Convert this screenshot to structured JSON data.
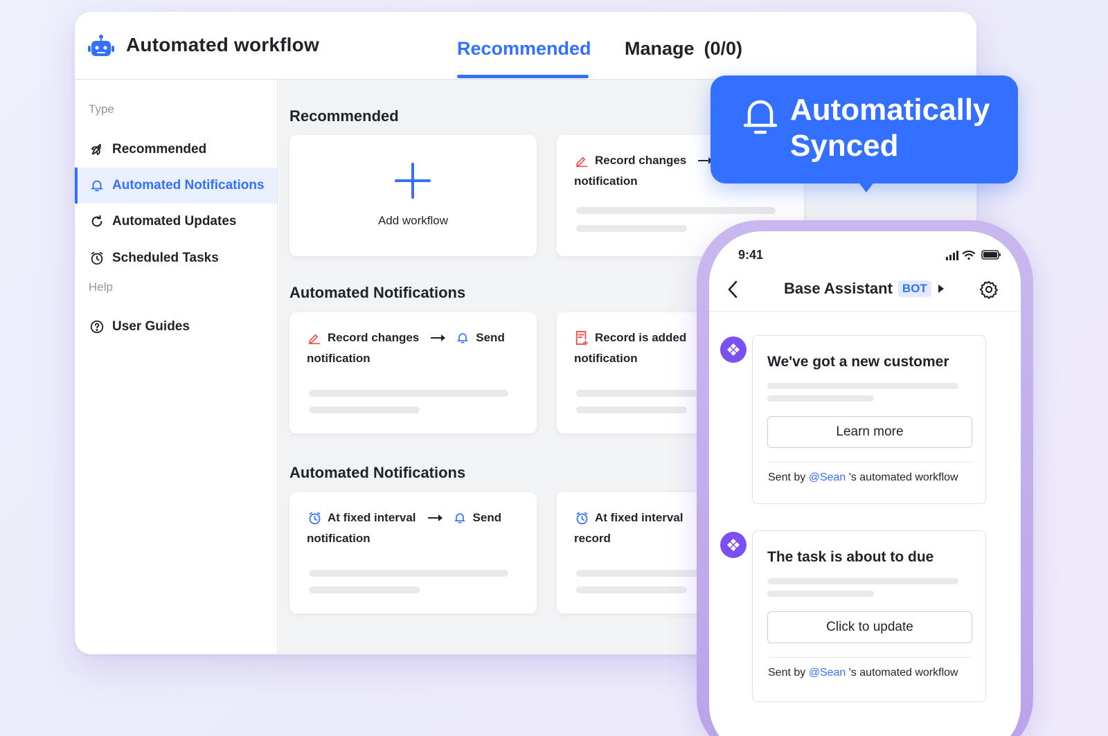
{
  "app": {
    "title": "Automated workflow"
  },
  "tabs": [
    {
      "label": "Recommended",
      "active": true
    },
    {
      "label": "Manage",
      "count": "(0/0)"
    }
  ],
  "sidebar": {
    "type_label": "Type",
    "help_label": "Help",
    "items": [
      {
        "label": "Recommended",
        "icon": "rocket-icon"
      },
      {
        "label": "Automated Notifications",
        "icon": "bell-icon",
        "active": true
      },
      {
        "label": "Automated Updates",
        "icon": "refresh-icon"
      },
      {
        "label": "Scheduled Tasks",
        "icon": "clock-icon"
      }
    ],
    "help_items": [
      {
        "label": "User Guides",
        "icon": "question-circle-icon"
      }
    ]
  },
  "sections": [
    {
      "title": "Recommended",
      "add_card": {
        "label": "Add workflow"
      },
      "cards": [
        {
          "trigger": "Record changes",
          "trigger_icon": "edit-icon",
          "line2": "notification"
        }
      ]
    },
    {
      "title": "Automated Notifications",
      "cards": [
        {
          "trigger": "Record changes",
          "trigger_icon": "edit-icon",
          "action": "Send",
          "action_icon": "bell-icon",
          "line2": "notification"
        },
        {
          "trigger": "Record is added",
          "trigger_icon": "form-add-icon",
          "line2": "notification"
        }
      ]
    },
    {
      "title": "Automated Notifications",
      "cards": [
        {
          "trigger": "At fixed interval",
          "trigger_icon": "alarm-clock-icon",
          "action": "Send",
          "action_icon": "bell-icon",
          "line2": "notification"
        },
        {
          "trigger": "At fixed interval",
          "trigger_icon": "alarm-clock-icon",
          "line2": "record"
        }
      ]
    }
  ],
  "bubble": {
    "line1": "Automatically",
    "line2": "Synced",
    "icon": "bell-icon"
  },
  "phone": {
    "time": "9:41",
    "chat_title": "Base Assistant",
    "badge": "BOT",
    "messages": [
      {
        "title": "We've got a new customer",
        "button": "Learn more",
        "sent_by": "Sent by",
        "mention": "@Sean",
        "suffix": "'s automated workflow"
      },
      {
        "title": "The task is about to due",
        "button": "Click to update",
        "sent_by": "Sent by",
        "mention": "@Sean",
        "suffix": "'s automated workflow"
      }
    ]
  },
  "colors": {
    "accent": "#3370ff",
    "text": "#1f2329",
    "danger_icon": "#f54a45",
    "avatar": "#7b4ff0",
    "phone_frame": "#c9b8ef"
  }
}
